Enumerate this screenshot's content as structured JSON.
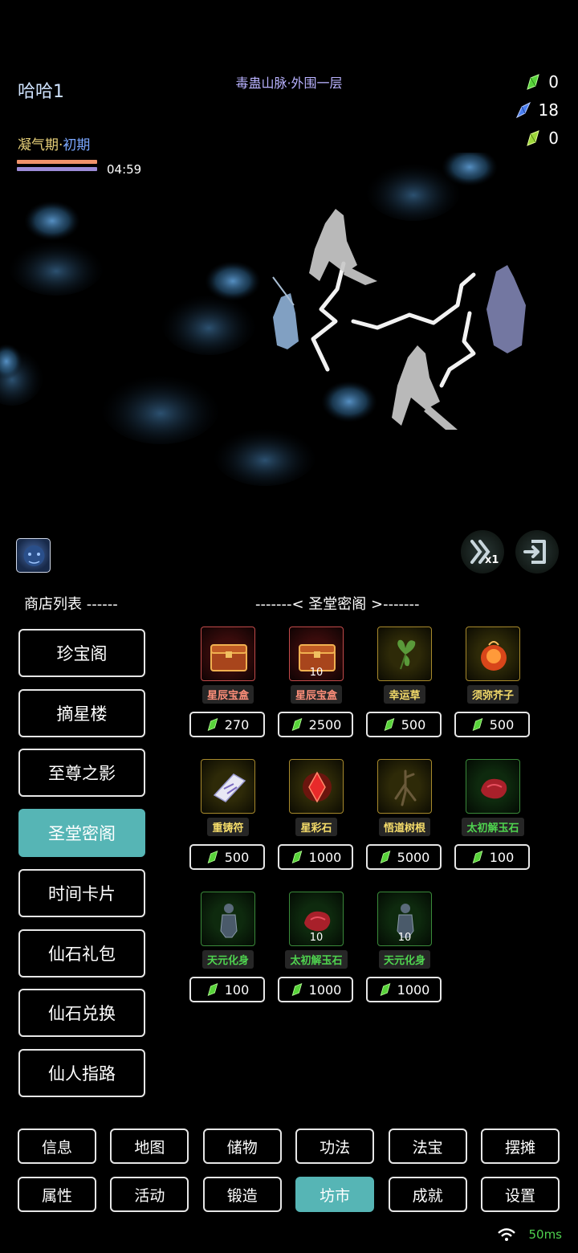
{
  "hud": {
    "player_name": "哈哈1",
    "location": "毒蛊山脉·外围一层",
    "realm_main": "凝气期·",
    "realm_stage": "初期",
    "timer": "04:59",
    "currencies": [
      {
        "icon": "green-spirit-stone-icon",
        "value": "0",
        "color": "#58d33a"
      },
      {
        "icon": "blue-crystal-icon",
        "value": "18",
        "color": "#4a7ff0"
      },
      {
        "icon": "yellow-green-stone-icon",
        "value": "0",
        "color": "#9ed83a"
      }
    ]
  },
  "controls": {
    "speed_label": "x1"
  },
  "shop": {
    "list_title": "商店列表 ------",
    "panel_title": "-------< 圣堂密阁 >-------",
    "tabs": [
      {
        "label": "珍宝阁",
        "active": false
      },
      {
        "label": "摘星楼",
        "active": false
      },
      {
        "label": "至尊之影",
        "active": false
      },
      {
        "label": "圣堂密阁",
        "active": true
      },
      {
        "label": "时间卡片",
        "active": false
      },
      {
        "label": "仙石礼包",
        "active": false
      },
      {
        "label": "仙石兑换",
        "active": false
      },
      {
        "label": "仙人指路",
        "active": false
      }
    ],
    "items": [
      {
        "name": "星辰宝盒",
        "qty": "",
        "price": "270",
        "name_color": "#ff8f7a",
        "icon": "treasure-chest-icon",
        "border": "#c24a4a",
        "bg": "#3a0c0c"
      },
      {
        "name": "星辰宝盒",
        "qty": "10",
        "price": "2500",
        "name_color": "#ff8f7a",
        "icon": "treasure-chest-icon",
        "border": "#c24a4a",
        "bg": "#3a0c0c"
      },
      {
        "name": "幸运草",
        "qty": "",
        "price": "500",
        "name_color": "#f5dc6a",
        "icon": "clover-icon",
        "border": "#a88a2c",
        "bg": "#2e2a08"
      },
      {
        "name": "须弥芥子",
        "qty": "",
        "price": "500",
        "name_color": "#f5dc6a",
        "icon": "fire-pouch-icon",
        "border": "#a88a2c",
        "bg": "#2e2a08"
      },
      {
        "name": "重铸符",
        "qty": "",
        "price": "500",
        "name_color": "#f5dc6a",
        "icon": "talisman-scroll-icon",
        "border": "#a88a2c",
        "bg": "#2e2a08"
      },
      {
        "name": "星彩石",
        "qty": "",
        "price": "1000",
        "name_color": "#f5dc6a",
        "icon": "star-stone-icon",
        "border": "#a88a2c",
        "bg": "#2e2a08"
      },
      {
        "name": "悟道树根",
        "qty": "",
        "price": "5000",
        "name_color": "#f5dc6a",
        "icon": "tree-root-icon",
        "border": "#a88a2c",
        "bg": "#2e2a08"
      },
      {
        "name": "太初解玉石",
        "qty": "",
        "price": "100",
        "name_color": "#4fd44f",
        "icon": "red-jade-icon",
        "border": "#3a8a3a",
        "bg": "#0e2a0e"
      },
      {
        "name": "天元化身",
        "qty": "",
        "price": "100",
        "name_color": "#4fd44f",
        "icon": "avatar-statue-icon",
        "border": "#3a8a3a",
        "bg": "#0e2a0e"
      },
      {
        "name": "太初解玉石",
        "qty": "10",
        "price": "1000",
        "name_color": "#4fd44f",
        "icon": "red-jade-icon",
        "border": "#3a8a3a",
        "bg": "#0e2a0e"
      },
      {
        "name": "天元化身",
        "qty": "10",
        "price": "1000",
        "name_color": "#4fd44f",
        "icon": "avatar-statue-icon",
        "border": "#3a8a3a",
        "bg": "#0e2a0e"
      }
    ]
  },
  "nav": {
    "row1": [
      {
        "label": "信息",
        "active": false
      },
      {
        "label": "地图",
        "active": false
      },
      {
        "label": "储物",
        "active": false
      },
      {
        "label": "功法",
        "active": false
      },
      {
        "label": "法宝",
        "active": false
      },
      {
        "label": "摆摊",
        "active": false
      }
    ],
    "row2": [
      {
        "label": "属性",
        "active": false
      },
      {
        "label": "活动",
        "active": false
      },
      {
        "label": "锻造",
        "active": false
      },
      {
        "label": "坊市",
        "active": true
      },
      {
        "label": "成就",
        "active": false
      },
      {
        "label": "设置",
        "active": false
      }
    ]
  },
  "status": {
    "ping": "50ms"
  }
}
